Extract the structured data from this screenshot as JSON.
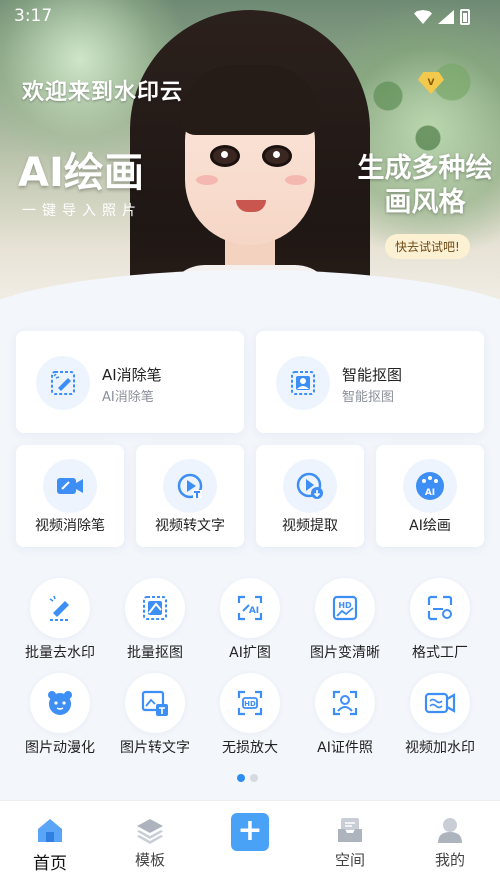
{
  "status_bar": {
    "time": "3:17"
  },
  "hero": {
    "welcome": "欢迎来到水印云",
    "vip_badge": "V",
    "title": "AI绘画",
    "subtitle": "一键导入照片",
    "right_text_line1": "生成多种绘",
    "right_text_line2": "画风格",
    "try_button": "快去试试吧!"
  },
  "feature_cards": [
    {
      "title": "AI消除笔",
      "subtitle": "AI消除笔",
      "icon": "eraser-pen-icon"
    },
    {
      "title": "智能抠图",
      "subtitle": "智能抠图",
      "icon": "cutout-image-icon"
    }
  ],
  "mid_tools": [
    {
      "label": "视频消除笔",
      "icon": "video-eraser-icon"
    },
    {
      "label": "视频转文字",
      "icon": "video-to-text-icon"
    },
    {
      "label": "视频提取",
      "icon": "video-extract-icon"
    },
    {
      "label": "AI绘画",
      "icon": "ai-palette-icon"
    }
  ],
  "grid_tools": [
    {
      "label": "批量去水印",
      "icon": "batch-remove-watermark-icon"
    },
    {
      "label": "批量抠图",
      "icon": "batch-cutout-icon"
    },
    {
      "label": "AI扩图",
      "icon": "ai-expand-icon"
    },
    {
      "label": "图片变清晰",
      "icon": "hd-image-icon"
    },
    {
      "label": "格式工厂",
      "icon": "format-factory-icon"
    },
    {
      "label": "图片动漫化",
      "icon": "anime-face-icon"
    },
    {
      "label": "图片转文字",
      "icon": "image-to-text-icon"
    },
    {
      "label": "无损放大",
      "icon": "lossless-upscale-icon"
    },
    {
      "label": "AI证件照",
      "icon": "id-photo-icon"
    },
    {
      "label": "视频加水印",
      "icon": "video-watermark-icon"
    }
  ],
  "tabbar": [
    {
      "label": "首页",
      "icon": "home-icon",
      "active": true
    },
    {
      "label": "模板",
      "icon": "layers-icon",
      "active": false
    },
    {
      "label": "",
      "icon": "plus-icon",
      "active": false
    },
    {
      "label": "空间",
      "icon": "inbox-icon",
      "active": false
    },
    {
      "label": "我的",
      "icon": "user-icon",
      "active": false
    }
  ],
  "colors": {
    "accent": "#2f8cf0",
    "icon_blue": "#3d8ef5",
    "background": "#f3f6fb"
  }
}
